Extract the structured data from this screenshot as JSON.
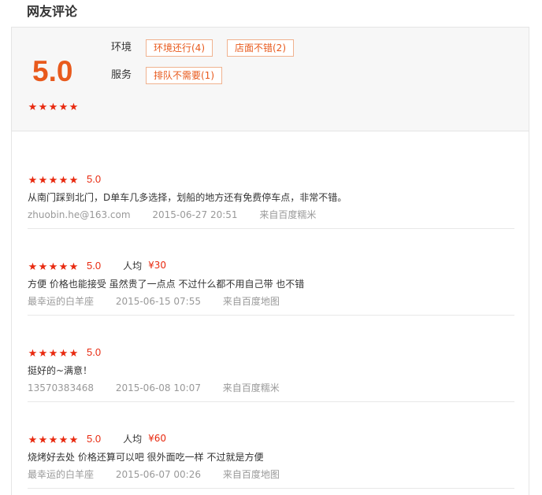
{
  "section_title": "网友评论",
  "summary": {
    "overall_score": "5.0",
    "overall_stars": 5,
    "tag_groups": [
      {
        "label": "环境",
        "tags": [
          "环境还行(4)",
          "店面不错(2)"
        ]
      },
      {
        "label": "服务",
        "tags": [
          "排队不需要(1)"
        ]
      }
    ]
  },
  "reviews": [
    {
      "stars": 5,
      "score": "5.0",
      "avg_label": "",
      "avg_price": "",
      "text": "从南门踩到北门，D单车几多选择，划船的地方还有免费停车点，非常不错。",
      "author": "zhuobin.he@163.com",
      "time": "2015-06-27 20:51",
      "source": "来自百度糯米"
    },
    {
      "stars": 5,
      "score": "5.0",
      "avg_label": "人均",
      "avg_price": "¥30",
      "text": "方便 价格也能接受 虽然贵了一点点 不过什么都不用自己带 也不错",
      "author": "最幸运的白羊座",
      "time": "2015-06-15 07:55",
      "source": "来自百度地图"
    },
    {
      "stars": 5,
      "score": "5.0",
      "avg_label": "",
      "avg_price": "",
      "text": "挺好的~满意！",
      "author": "13570383468",
      "time": "2015-06-08 10:07",
      "source": "来自百度糯米"
    },
    {
      "stars": 5,
      "score": "5.0",
      "avg_label": "人均",
      "avg_price": "¥60",
      "text": "烧烤好去处 价格还算可以吧 很外面吃一样 不过就是方便",
      "author": "最幸运的白羊座",
      "time": "2015-06-07 00:26",
      "source": "来自百度地图"
    }
  ],
  "colors": {
    "accent_orange": "#e85a1d",
    "star_red": "#e8290f",
    "tag_border": "#f0b28f"
  },
  "icons": {
    "star": "star-icon"
  }
}
